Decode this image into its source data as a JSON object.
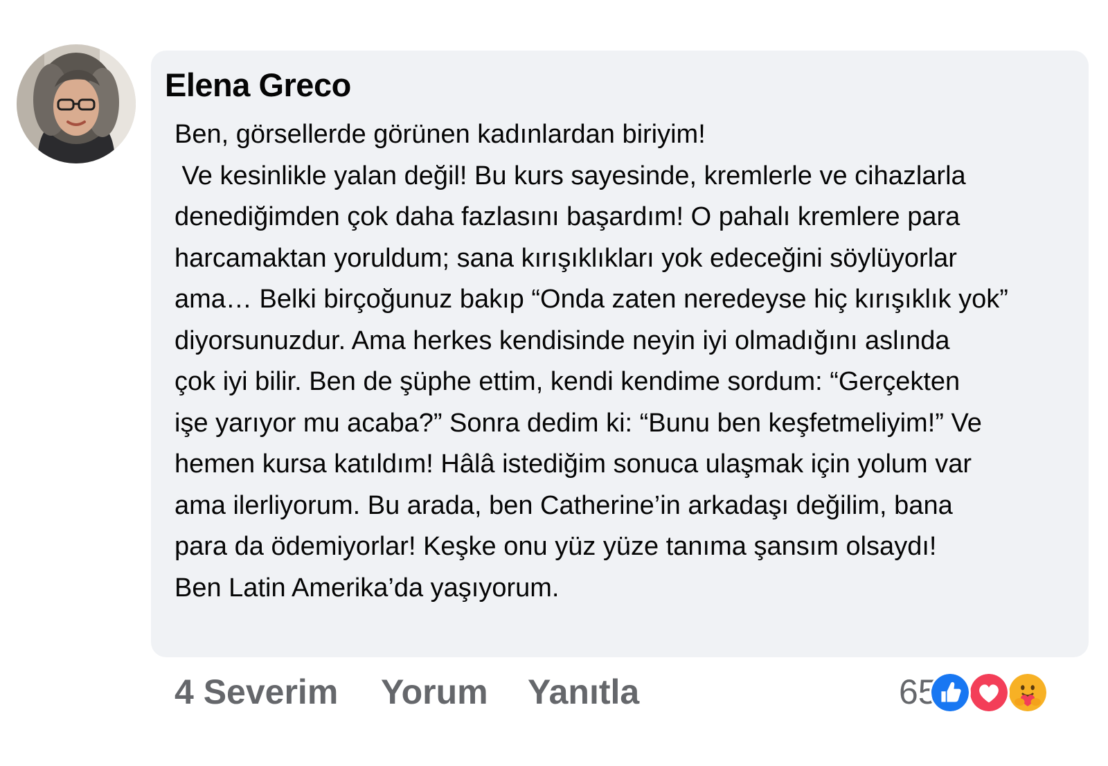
{
  "comment": {
    "author_name": "Elena Greco",
    "avatar_icon": "user-avatar-photo",
    "body_lines": [
      "Ben, görsellerde görünen kadınlardan biriyim!",
      " Ve kesinlikle yalan değil! Bu kurs sayesinde, kremlerle ve cihazlarla",
      "denediğimden çok daha fazlasını başardım! O pahalı kremlere para",
      "harcamaktan yoruldum; sana kırışıklıkları yok edeceğini söylüyorlar",
      "ama… Belki birçoğunuz bakıp “Onda zaten neredeyse hiç kırışıklık yok”",
      "diyorsunuzdur. Ama herkes kendisinde neyin iyi olmadığını aslında",
      "çok iyi bilir. Ben de şüphe ettim, kendi kendime sordum: “Gerçekten",
      "işe yarıyor mu acaba?” Sonra dedim ki: “Bunu ben keşfetmeliyim!” Ve",
      "hemen kursa katıldım! Hâlâ istediğim sonuca ulaşmak için yolum var",
      "ama ilerliyorum. Bu arada, ben Catherine’in arkadaşı değilim, bana",
      "para da ödemiyorlar! Keşke onu yüz yüze tanıma şansım olsaydı!",
      "Ben Latin Amerika’da yaşıyorum."
    ]
  },
  "actions": {
    "like_label": "4 Severim",
    "comment_label": "Yorum",
    "reply_label": "Yanıtla"
  },
  "reactions": {
    "count": "65",
    "icons": [
      "like-reaction-icon",
      "love-reaction-icon",
      "care-reaction-icon"
    ]
  },
  "colors": {
    "bubble_bg": "#f0f2f5",
    "text": "#050505",
    "secondary_text": "#65676b",
    "like_blue": "#1877f2",
    "love_red": "#f33e58",
    "care_yellow": "#f7b125"
  }
}
